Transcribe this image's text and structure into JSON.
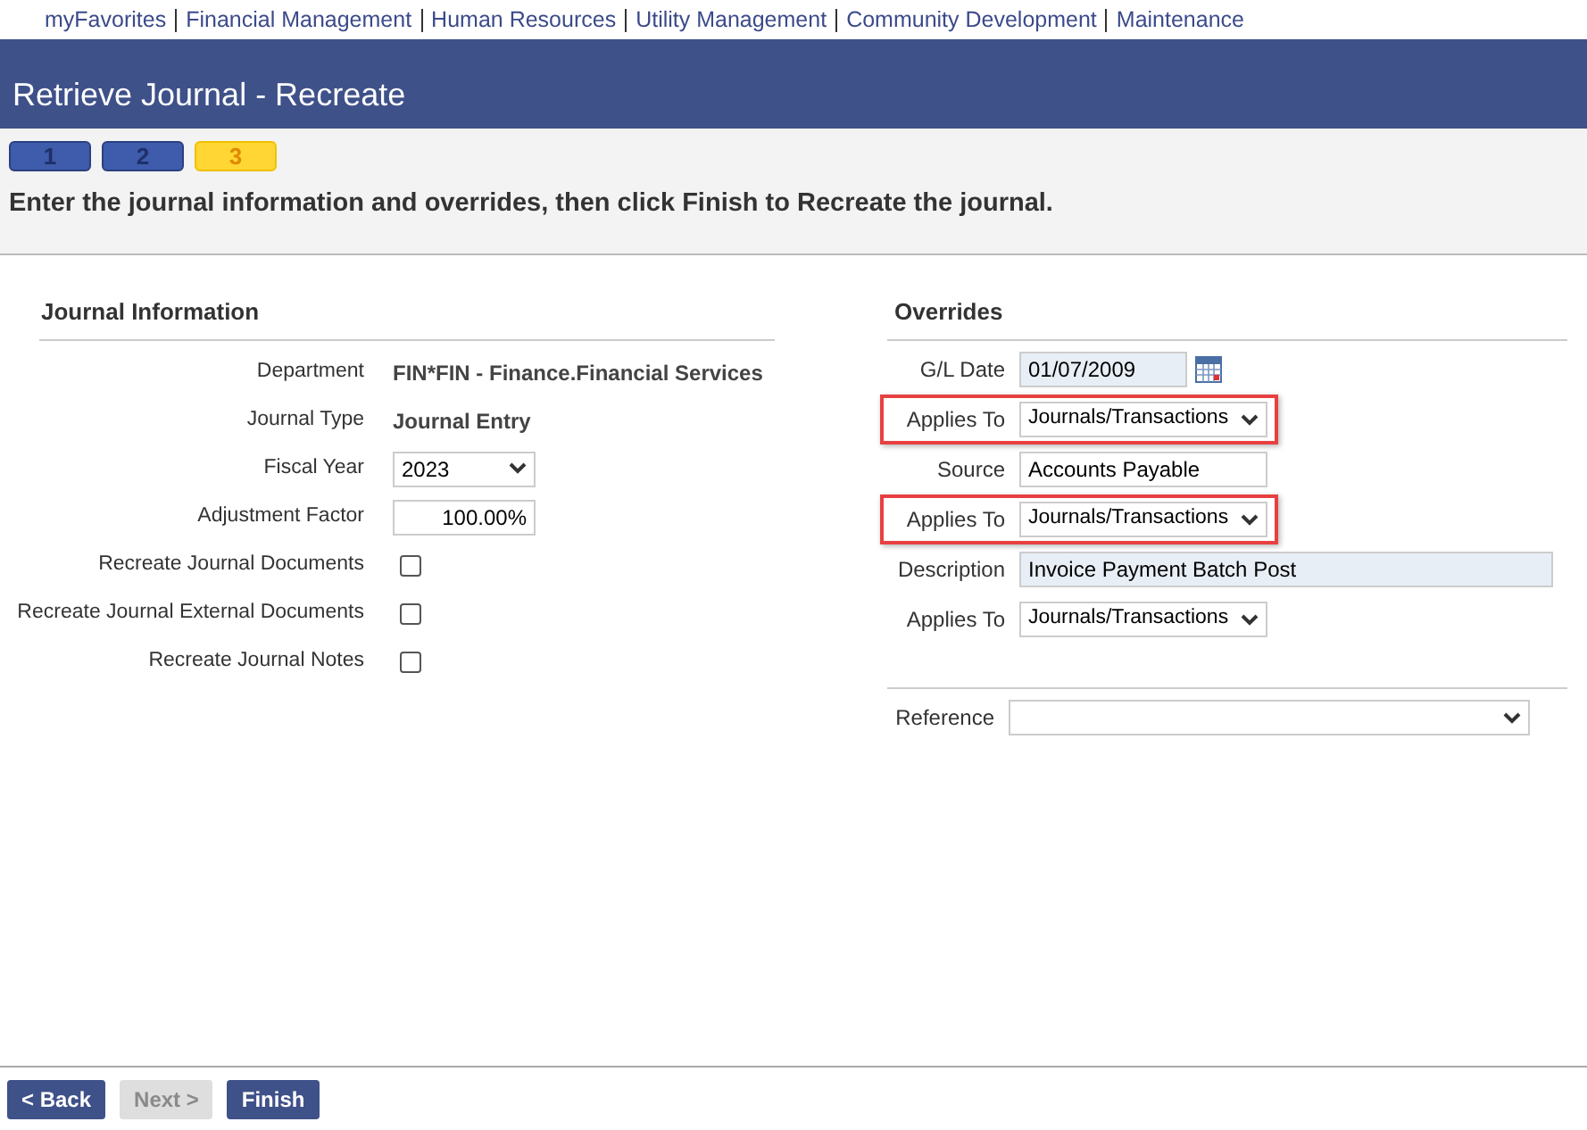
{
  "nav": [
    "myFavorites",
    "Financial Management",
    "Human Resources",
    "Utility Management",
    "Community Development",
    "Maintenance"
  ],
  "title": "Retrieve Journal - Recreate",
  "steps": [
    {
      "label": "1",
      "selected": false
    },
    {
      "label": "2",
      "selected": false
    },
    {
      "label": "3",
      "selected": true
    }
  ],
  "instruction": "Enter the journal information and overrides, then click Finish to Recreate the journal.",
  "journal_information": {
    "heading": "Journal Information",
    "rows": [
      {
        "kind": "text",
        "label": "Department",
        "value": "FIN*FIN - Finance.Financial Services"
      },
      {
        "kind": "text",
        "label": "Journal Type",
        "value": "Journal Entry"
      },
      {
        "kind": "select",
        "label": "Fiscal Year",
        "value": "2023"
      },
      {
        "kind": "input",
        "label": "Adjustment Factor",
        "value": "100.00%"
      },
      {
        "kind": "checkbox",
        "label": "Recreate Journal Documents",
        "checked": false
      },
      {
        "kind": "checkbox",
        "label": "Recreate Journal External Documents",
        "checked": false
      },
      {
        "kind": "checkbox",
        "label": "Recreate Journal Notes",
        "checked": false
      }
    ]
  },
  "overrides": {
    "heading": "Overrides",
    "rows": [
      {
        "kind": "date",
        "label": "G/L Date",
        "value": "01/07/2009",
        "highlighted": false
      },
      {
        "kind": "select",
        "label": "Applies To",
        "value": "Journals/Transactions",
        "highlighted": true
      },
      {
        "kind": "input",
        "label": "Source",
        "value": "Accounts Payable",
        "highlighted": false
      },
      {
        "kind": "select",
        "label": "Applies To",
        "value": "Journals/Transactions",
        "highlighted": true
      },
      {
        "kind": "wide",
        "label": "Description",
        "value": "Invoice Payment Batch Post",
        "highlighted": false
      },
      {
        "kind": "select",
        "label": "Applies To",
        "value": "Journals/Transactions",
        "highlighted": false
      }
    ],
    "reference": {
      "label": "Reference"
    }
  },
  "buttons": [
    {
      "label": "< Back",
      "disabled": false
    },
    {
      "label": "Next >",
      "disabled": true
    },
    {
      "label": "Finish",
      "disabled": false
    }
  ]
}
